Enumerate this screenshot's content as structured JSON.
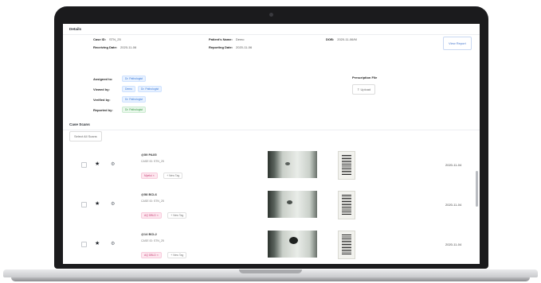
{
  "details": {
    "title": "Details",
    "case_id_label": "Case ID:",
    "case_id_value": "STN_25",
    "patient_label": "Patient's Name:",
    "patient_value": "Demo",
    "dob_label": "DOB:",
    "dob_value": "2020-11-06/M",
    "receiving_label": "Receiving Date:",
    "receiving_value": "2020-11-06",
    "reporting_label": "Reporting Date:",
    "reporting_value": "2020-11-06",
    "view_report_label": "View Report"
  },
  "assignments": {
    "assigned_label": "Assigned to:",
    "assigned_chip": "Dr. Pathologist",
    "viewed_label": "Viewed by:",
    "viewed_chips": [
      "Demo",
      "Dr. Pathologist"
    ],
    "verified_label": "Verified by:",
    "verified_chip": "Dr. Pathologist",
    "reported_label": "Reported by:",
    "reported_chip": "Dr. Pathologist"
  },
  "prescription": {
    "label": "Prescription File",
    "upload_label": "Upload"
  },
  "case_scans": {
    "title": "Case Scans",
    "select_all_label": "Select All Scans",
    "scans": [
      {
        "name": "@59 PAX5",
        "case_id": "CASE ID: STN_25",
        "tag": "Myeloi ×",
        "new_tag": "+ New Tag",
        "date": "2020-11-04"
      },
      {
        "name": "@58 BCL6",
        "case_id": "CASE ID: STN_25",
        "tag": "AQ DBLD ×",
        "new_tag": "+ New Tag",
        "date": "2020-11-04"
      },
      {
        "name": "@14 BCL2",
        "case_id": "CASE ID: STN_25",
        "tag": "AQ DBLD ×",
        "new_tag": "+ New Tag",
        "date": "2020-11-04"
      }
    ]
  },
  "icons": {
    "star": "★",
    "gear": "⚙"
  },
  "colors": {
    "accent": "#4a7bd0",
    "chip_blue": "#3d7bd8",
    "chip_green": "#3a9a4a",
    "chip_pink": "#c8467a"
  }
}
